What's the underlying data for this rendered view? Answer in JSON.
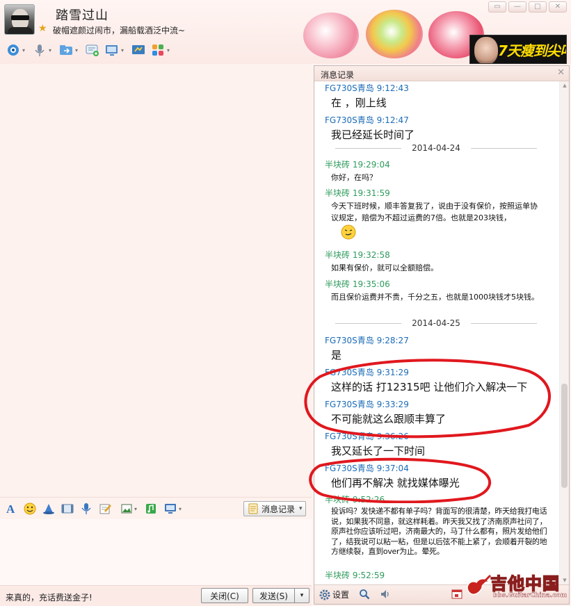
{
  "header": {
    "nickname": "踏雪过山",
    "signature": "破帽遮颜过闹市，漏船载酒泛中流~",
    "ad_text": "7天瘦到尖叫",
    "toolbar_icons": [
      "video-call-icon",
      "voice-call-icon",
      "file-transfer-icon",
      "sms-icon",
      "remote-desktop-icon",
      "screen-share-icon",
      "apps-icon"
    ]
  },
  "input_toolbar": {
    "icons": [
      "font-icon",
      "emoji-icon",
      "nudge-icon",
      "magic-expression-icon",
      "voice-message-icon",
      "scribble-icon",
      "screenshot-icon",
      "music-icon",
      "screen-capture-icon"
    ],
    "history_label": "消息记录"
  },
  "bottom": {
    "ad_line": "来真的，充话费送金子!",
    "close_label": "关闭(C)",
    "send_label": "发送(S)"
  },
  "history": {
    "title": "消息记录",
    "footer_settings": "设置",
    "entries": [
      {
        "sender": "FG730S青岛",
        "time": "9:12:43",
        "text": "在 ，刚上线"
      },
      {
        "sender": "FG730S青岛",
        "time": "9:12:47",
        "text": "我已经延长时间了"
      },
      {
        "date": "2014-04-24"
      },
      {
        "sender": "半块砖",
        "time": "19:29:04",
        "text": "你好，在吗？"
      },
      {
        "sender": "半块砖",
        "time": "19:31:59",
        "text": "今天下班时候，顺丰答复我了，说由于没有保价，按照运单协议规定，赔偿为不超过运费的7倍。也就是203块钱，"
      },
      {
        "sender": "半块砖",
        "time": "19:32:58",
        "text": "如果有保价，就可以全额赔偿。"
      },
      {
        "sender": "半块砖",
        "time": "19:35:06",
        "text": "而且保价运费并不贵，千分之五，也就是1000块钱才5块钱。"
      },
      {
        "date": "2014-04-25"
      },
      {
        "sender": "FG730S青岛",
        "time": "9:28:27",
        "text": "是"
      },
      {
        "sender": "FG730S青岛",
        "time": "9:31:29",
        "text": "这样的话 打12315吧 让他们介入解决一下"
      },
      {
        "sender": "FG730S青岛",
        "time": "9:33:29",
        "text": "不可能就这么跟顺丰算了"
      },
      {
        "sender": "FG730S青岛",
        "time": "9:36:26",
        "text": "我又延长了一下时间"
      },
      {
        "sender": "FG730S青岛",
        "time": "9:37:04",
        "text": "他们再不解决 就找媒体曝光"
      },
      {
        "sender": "半块砖",
        "time": "9:52:26",
        "text": "投诉吗？发快递不都有单子吗？背面写的很清楚，昨天给我打电话说，如果我不同意，就这样耗着。昨天我又找了济南原声社问了，原声社你应该听过吧，济南最大的，马丁什么都有，照片发给他们了，结我说可以粘一粘，但是以后弦不能上紧了，会顺着开裂的地方继续裂，直到over为止。晕死。"
      },
      {
        "sender": "半块砖",
        "time": "9:52:59",
        "text": ""
      }
    ]
  },
  "watermark": {
    "title": "吉他中国",
    "url": "bbs.GuitarChina.com"
  },
  "colors": {
    "them": "#1a6bb8",
    "me": "#2e9b5c",
    "annotation": "#e0181e"
  }
}
